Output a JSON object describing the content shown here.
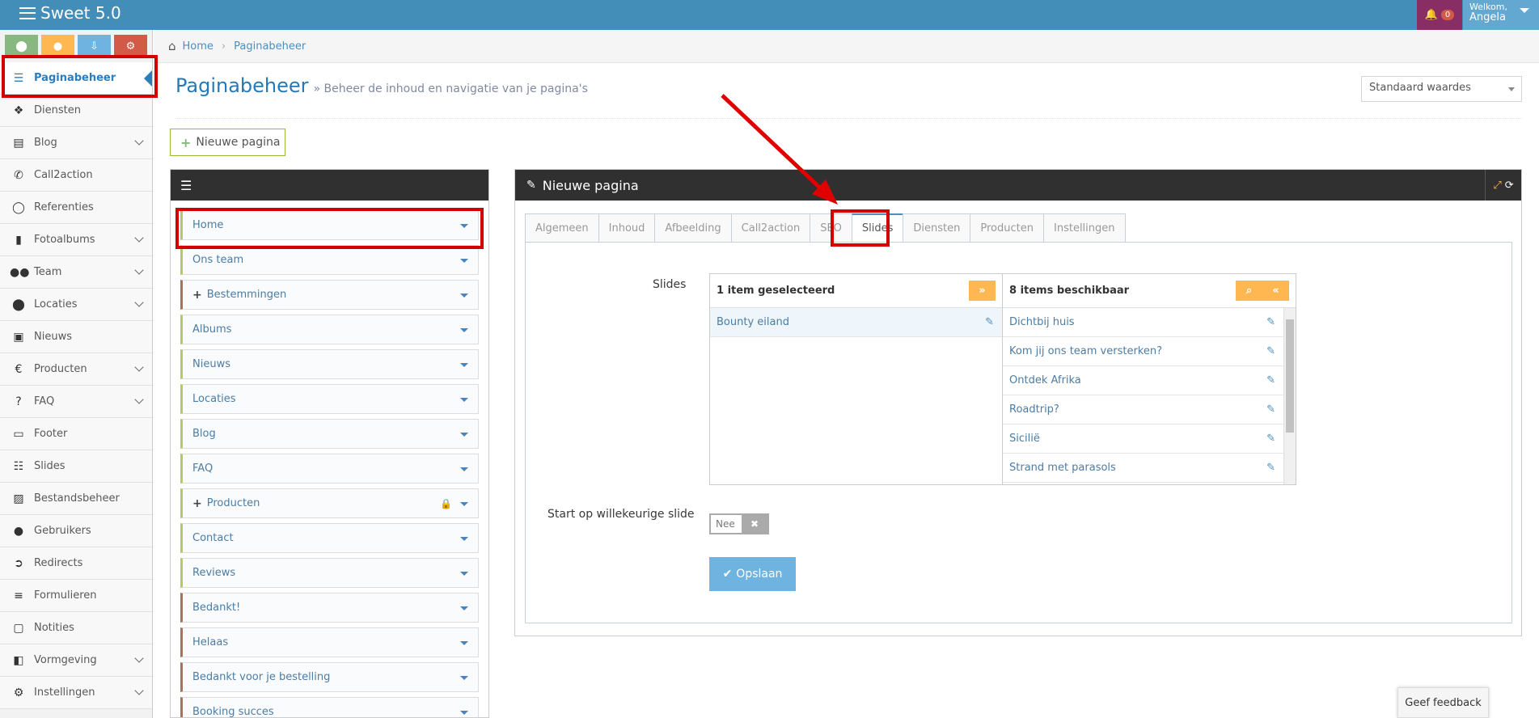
{
  "app": {
    "title": "Sweet 5.0"
  },
  "topbar": {
    "notification_count": "0",
    "welcome": "Welkom,",
    "username": "Angela"
  },
  "shortcuts": [
    {
      "icon": "map-marker-icon",
      "color": "#87b87f"
    },
    {
      "icon": "user-icon",
      "color": "#ffb752"
    },
    {
      "icon": "download-icon",
      "color": "#6fb3e0"
    },
    {
      "icon": "cogs-icon",
      "color": "#d15b47"
    }
  ],
  "sidebar": {
    "items": [
      {
        "label": "Paginabeheer",
        "icon": "bars-icon",
        "active": true
      },
      {
        "label": "Diensten",
        "icon": "cubes-icon"
      },
      {
        "label": "Blog",
        "icon": "file-text-icon",
        "expandable": true
      },
      {
        "label": "Call2action",
        "icon": "phone-icon"
      },
      {
        "label": "Referenties",
        "icon": "comment-icon"
      },
      {
        "label": "Fotoalbums",
        "icon": "book-icon",
        "expandable": true
      },
      {
        "label": "Team",
        "icon": "users-icon",
        "expandable": true
      },
      {
        "label": "Locaties",
        "icon": "map-marker-icon",
        "expandable": true
      },
      {
        "label": "Nieuws",
        "icon": "newspaper-icon"
      },
      {
        "label": "Producten",
        "icon": "euro-icon",
        "expandable": true
      },
      {
        "label": "FAQ",
        "icon": "question-circle-icon",
        "expandable": true
      },
      {
        "label": "Footer",
        "icon": "list-alt-icon"
      },
      {
        "label": "Slides",
        "icon": "sliders-icon"
      },
      {
        "label": "Bestandsbeheer",
        "icon": "picture-icon"
      },
      {
        "label": "Gebruikers",
        "icon": "user-icon"
      },
      {
        "label": "Redirects",
        "icon": "arrow-circle-right-icon"
      },
      {
        "label": "Formulieren",
        "icon": "list-icon"
      },
      {
        "label": "Notities",
        "icon": "edit-icon"
      },
      {
        "label": "Vormgeving",
        "icon": "columns-icon",
        "expandable": true
      },
      {
        "label": "Instellingen",
        "icon": "cog-icon",
        "expandable": true
      }
    ]
  },
  "breadcrumb": {
    "home": "Home",
    "current": "Paginabeheer"
  },
  "page": {
    "title": "Paginabeheer",
    "subtitle": "» Beheer de inhoud en navigatie van je pagina's",
    "select_value": "Standaard waardes",
    "new_button": "Nieuwe pagina"
  },
  "tree": {
    "items": [
      {
        "label": "Home",
        "style": "green"
      },
      {
        "label": "Ons team",
        "style": "green"
      },
      {
        "label": "Bestemmingen",
        "style": "brown",
        "plus": true
      },
      {
        "label": "Albums",
        "style": "green"
      },
      {
        "label": "Nieuws",
        "style": "green"
      },
      {
        "label": "Locaties",
        "style": "green"
      },
      {
        "label": "Blog",
        "style": "green"
      },
      {
        "label": "FAQ",
        "style": "green"
      },
      {
        "label": "Producten",
        "style": "green",
        "plus": true,
        "locked": true
      },
      {
        "label": "Contact",
        "style": "green"
      },
      {
        "label": "Reviews",
        "style": "green"
      },
      {
        "label": "Bedankt!",
        "style": "brown"
      },
      {
        "label": "Helaas",
        "style": "brown"
      },
      {
        "label": "Bedankt voor je bestelling",
        "style": "brown"
      },
      {
        "label": "Booking succes",
        "style": "brown"
      }
    ]
  },
  "form": {
    "title": "Nieuwe pagina",
    "tabs": [
      "Algemeen",
      "Inhoud",
      "Afbeelding",
      "Call2action",
      "SEO",
      "Slides",
      "Diensten",
      "Producten",
      "Instellingen"
    ],
    "active_tab": "Slides",
    "slides_label": "Slides",
    "selected_header": "1 item geselecteerd",
    "selected_items": [
      "Bounty eiland"
    ],
    "available_header": "8 items beschikbaar",
    "available_items": [
      "Dichtbij huis",
      "Kom jij ons team versterken?",
      "Ontdek Afrika",
      "Roadtrip?",
      "Sicilië",
      "Strand met parasols"
    ],
    "random_label": "Start op willekeurige slide",
    "toggle_value": "Nee",
    "save_label": "Opslaan"
  },
  "feedback": "Geef feedback"
}
